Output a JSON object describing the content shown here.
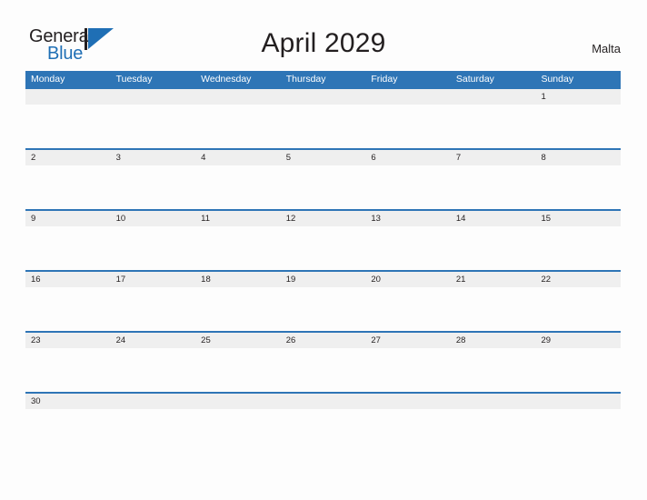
{
  "brand": {
    "word_one": "General",
    "word_two": "Blue",
    "mark_icon": "general-blue-triangle-logo",
    "accent_color": "#1f6fb5",
    "text_color": "#231f20"
  },
  "header": {
    "title": "April 2029",
    "region": "Malta"
  },
  "theme": {
    "header_band": "#2e75b6",
    "daynum_band": "#efefef",
    "separator": "#2e75b6",
    "page_background": "#fdfdfd"
  },
  "calendar": {
    "month": "April",
    "year": "2029",
    "week_start": "Monday",
    "weekdays": [
      "Monday",
      "Tuesday",
      "Wednesday",
      "Thursday",
      "Friday",
      "Saturday",
      "Sunday"
    ],
    "weeks": [
      {
        "days": [
          "",
          "",
          "",
          "",
          "",
          "",
          "1"
        ]
      },
      {
        "days": [
          "2",
          "3",
          "4",
          "5",
          "6",
          "7",
          "8"
        ]
      },
      {
        "days": [
          "9",
          "10",
          "11",
          "12",
          "13",
          "14",
          "15"
        ]
      },
      {
        "days": [
          "16",
          "17",
          "18",
          "19",
          "20",
          "21",
          "22"
        ]
      },
      {
        "days": [
          "23",
          "24",
          "25",
          "26",
          "27",
          "28",
          "29"
        ]
      },
      {
        "days": [
          "30",
          "",
          "",
          "",
          "",
          "",
          ""
        ]
      }
    ]
  }
}
